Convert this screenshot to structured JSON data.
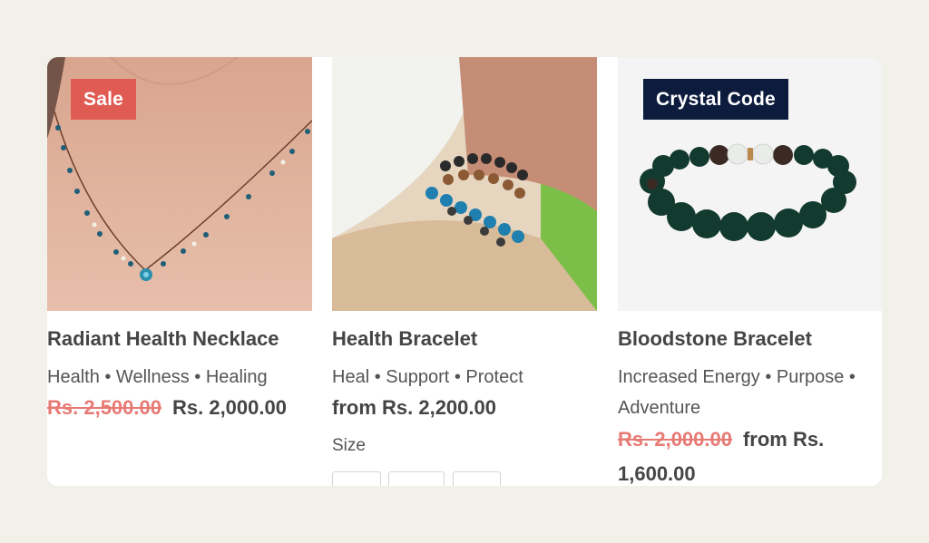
{
  "products": [
    {
      "badge": "Sale",
      "title": "Radiant Health Necklace",
      "tags": "Health • Wellness • Healing",
      "original_price": "Rs. 2,500.00",
      "price": "Rs. 2,000.00"
    },
    {
      "title": "Health Bracelet",
      "tags": "Heal • Support • Protect",
      "price": "from Rs. 2,200.00",
      "size_label": "Size"
    },
    {
      "badge": "Crystal Code",
      "title": "Bloodstone Bracelet",
      "tags": "Increased Energy • Purpose • Adventure",
      "original_price": "Rs. 2,000.00",
      "price": "from Rs. 1,600.00"
    }
  ],
  "colors": {
    "sale_badge": "#e05b54",
    "crystal_badge": "#0d1b3d",
    "strike_price": "#e77a75",
    "background": "#f1f1ea"
  }
}
